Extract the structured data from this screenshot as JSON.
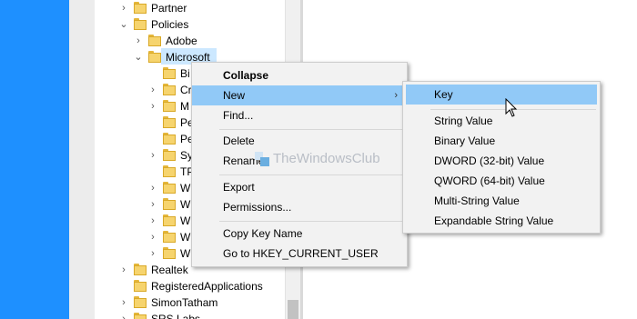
{
  "tree": {
    "items": [
      {
        "label": "Partner",
        "expander": "right"
      },
      {
        "label": "Policies",
        "expander": "down"
      },
      {
        "label": "Adobe",
        "expander": "right"
      },
      {
        "label": "Microsoft",
        "expander": "down",
        "selected": true
      },
      {
        "label": "Bi",
        "expander": "none"
      },
      {
        "label": "Cr",
        "expander": "right"
      },
      {
        "label": "M",
        "expander": "right"
      },
      {
        "label": "Pe",
        "expander": "none"
      },
      {
        "label": "Pe",
        "expander": "none"
      },
      {
        "label": "Sy",
        "expander": "right"
      },
      {
        "label": "TP",
        "expander": "none"
      },
      {
        "label": "W",
        "expander": "right"
      },
      {
        "label": "W",
        "expander": "right"
      },
      {
        "label": "W",
        "expander": "right"
      },
      {
        "label": "W",
        "expander": "right"
      },
      {
        "label": "W",
        "expander": "right"
      },
      {
        "label": "Realtek",
        "expander": "right"
      },
      {
        "label": "RegisteredApplications",
        "expander": "none"
      },
      {
        "label": "SimonTatham",
        "expander": "right"
      },
      {
        "label": "SRS Labs",
        "expander": "right"
      }
    ]
  },
  "context_menu": {
    "items": [
      {
        "label": "Collapse",
        "bold": true
      },
      {
        "label": "New",
        "submenu": true,
        "highlighted": true
      },
      {
        "label": "Find..."
      },
      {
        "label": "Delete"
      },
      {
        "label": "Rename"
      },
      {
        "label": "Export"
      },
      {
        "label": "Permissions..."
      },
      {
        "label": "Copy Key Name"
      },
      {
        "label": "Go to HKEY_CURRENT_USER"
      }
    ]
  },
  "new_submenu": {
    "items": [
      {
        "label": "Key",
        "highlighted": true
      },
      {
        "label": "String Value"
      },
      {
        "label": "Binary Value"
      },
      {
        "label": "DWORD (32-bit) Value"
      },
      {
        "label": "QWORD (64-bit) Value"
      },
      {
        "label": "Multi-String Value"
      },
      {
        "label": "Expandable String Value"
      }
    ]
  },
  "watermark": {
    "text": "TheWindowsClub"
  },
  "colors": {
    "desktop_accent": "#1e90ff",
    "menu_highlight": "#91c9f7",
    "selection": "#cce8ff",
    "folder": "#f6d46e"
  }
}
